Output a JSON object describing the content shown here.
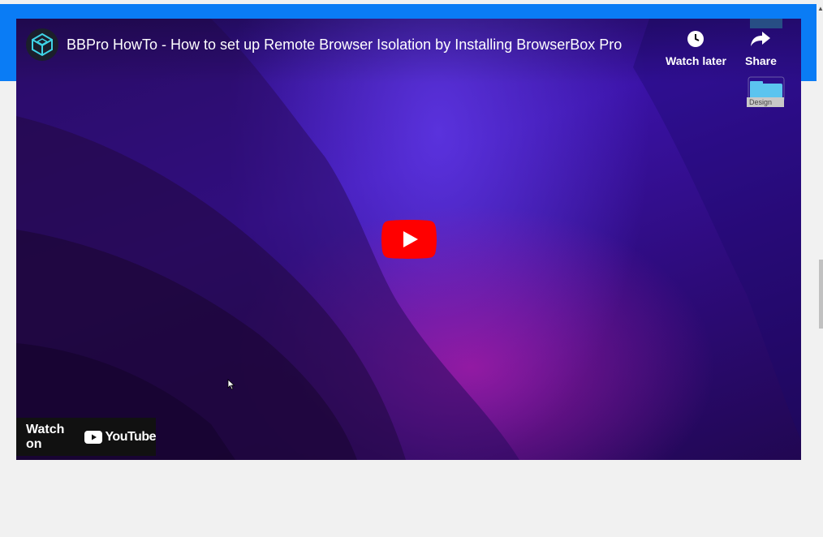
{
  "video": {
    "title": "BBPro HowTo - How to set up Remote Browser Isolation by Installing BrowserBox Pro",
    "watch_later_label": "Watch later",
    "share_label": "Share",
    "watch_on_label": "Watch on",
    "youtube_wordmark": "YouTube"
  },
  "desktop": {
    "folder_label": "Design"
  },
  "colors": {
    "page_background": "#f1f1f1",
    "top_band": "#0a7cf5",
    "play_red": "#ff0000"
  }
}
